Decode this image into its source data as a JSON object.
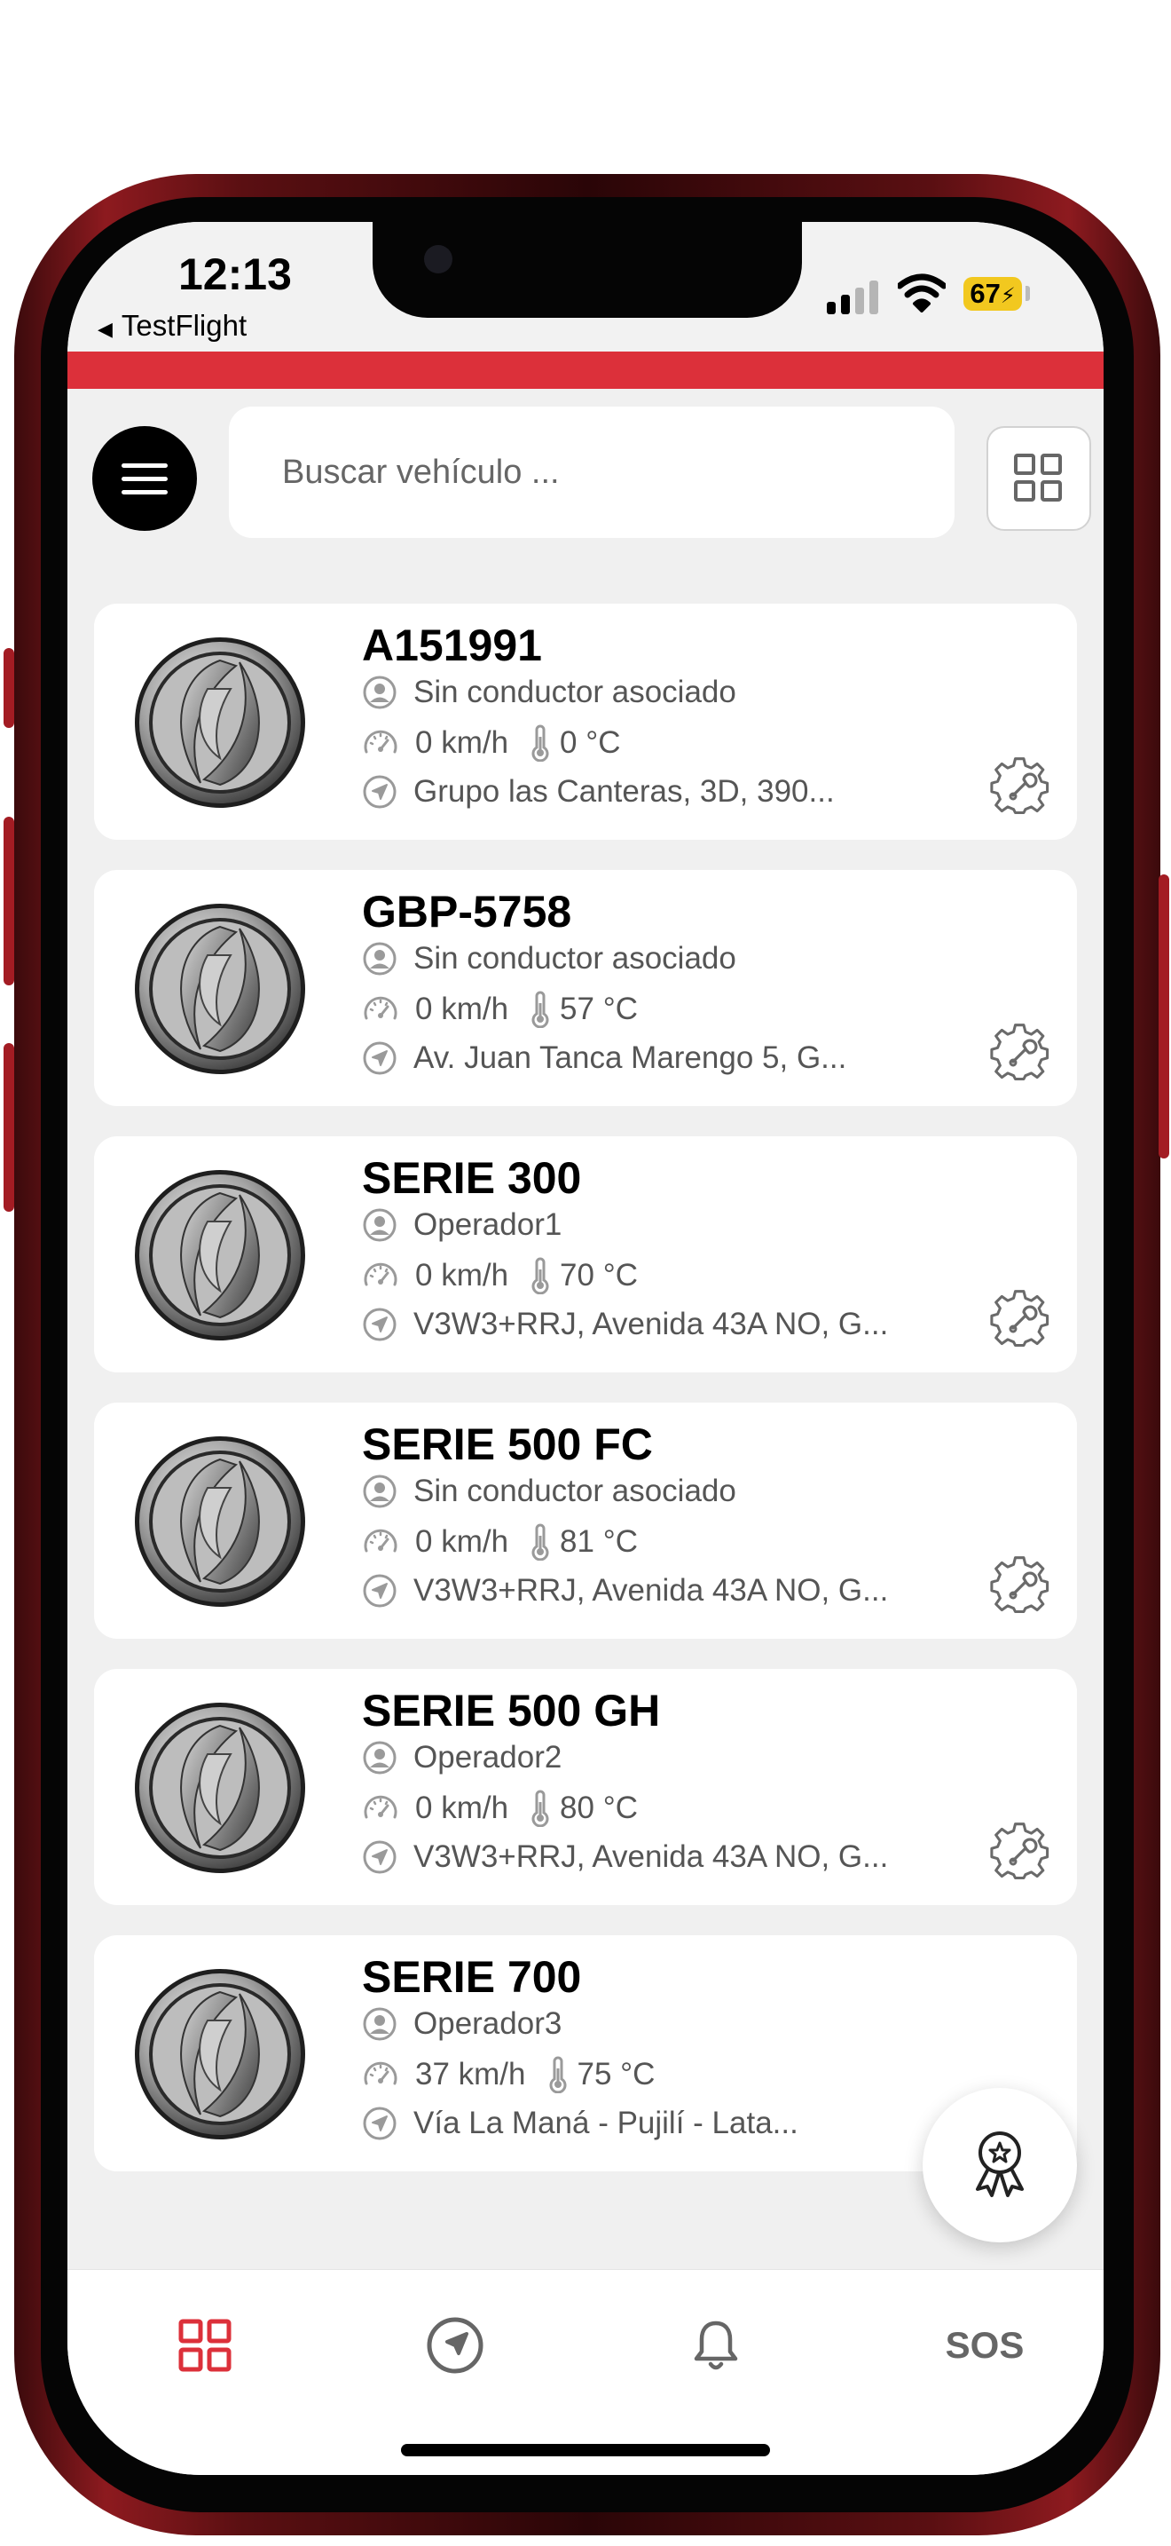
{
  "status_bar": {
    "time": "12:13",
    "back_app": "TestFlight",
    "battery": "67"
  },
  "search": {
    "placeholder": "Buscar vehículo ..."
  },
  "vehicles": [
    {
      "name": "A151991",
      "driver": "Sin conductor asociado",
      "speed": "0 km/h",
      "temp": "0 °C",
      "address": "Grupo las Canteras, 3D, 390..."
    },
    {
      "name": "GBP-5758",
      "driver": "Sin conductor asociado",
      "speed": "0 km/h",
      "temp": "57 °C",
      "address": "Av. Juan Tanca Marengo 5, G..."
    },
    {
      "name": "SERIE 300",
      "driver": "Operador1",
      "speed": "0 km/h",
      "temp": "70 °C",
      "address": "V3W3+RRJ, Avenida 43A NO, G..."
    },
    {
      "name": "SERIE 500 FC",
      "driver": "Sin conductor asociado",
      "speed": "0 km/h",
      "temp": "81 °C",
      "address": "V3W3+RRJ, Avenida 43A NO, G..."
    },
    {
      "name": "SERIE 500 GH",
      "driver": "Operador2",
      "speed": "0 km/h",
      "temp": "80 °C",
      "address": "V3W3+RRJ, Avenida 43A NO, G..."
    },
    {
      "name": "SERIE 700",
      "driver": "Operador3",
      "speed": "37 km/h",
      "temp": "75 °C",
      "address": "Vía La Maná - Pujilí - Lata..."
    }
  ],
  "bottom_nav": {
    "items": [
      "grid-icon",
      "navigation-icon",
      "bell-icon"
    ],
    "sos_label": "SOS"
  },
  "colors": {
    "accent": "#dc303a",
    "phone_frame": "#8d1a1f",
    "battery": "#f2c81f",
    "icon_gray": "#9a9a9a"
  }
}
